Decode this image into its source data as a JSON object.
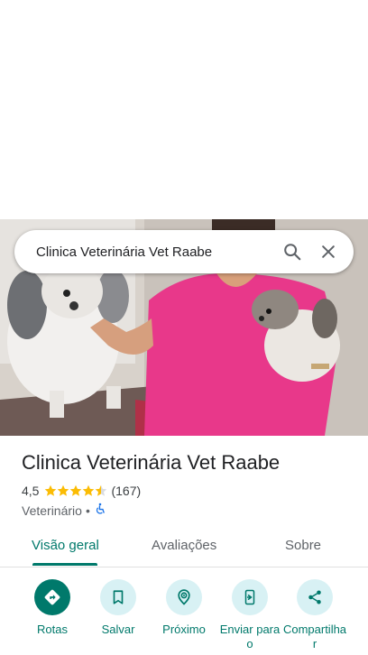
{
  "search": {
    "query": "Clinica Veterinária Vet Raabe"
  },
  "place": {
    "title": "Clinica Veterinária Vet Raabe",
    "rating": "4,5",
    "stars": 4.5,
    "review_count": "(167)",
    "category": "Veterinário",
    "separator": "•"
  },
  "tabs": [
    {
      "label": "Visão geral",
      "active": true
    },
    {
      "label": "Avaliações",
      "active": false
    },
    {
      "label": "Sobre",
      "active": false
    }
  ],
  "actions": [
    {
      "label": "Rotas",
      "icon": "directions-icon"
    },
    {
      "label": "Salvar",
      "icon": "bookmark-icon"
    },
    {
      "label": "Próximo",
      "icon": "nearby-icon"
    },
    {
      "label": "Enviar para o",
      "icon": "send-to-phone-icon"
    },
    {
      "label": "Compartilhar",
      "icon": "share-icon"
    }
  ],
  "colors": {
    "accent": "#00796b",
    "star": "#fbbc04",
    "chip_bg": "#d8f1f4"
  }
}
